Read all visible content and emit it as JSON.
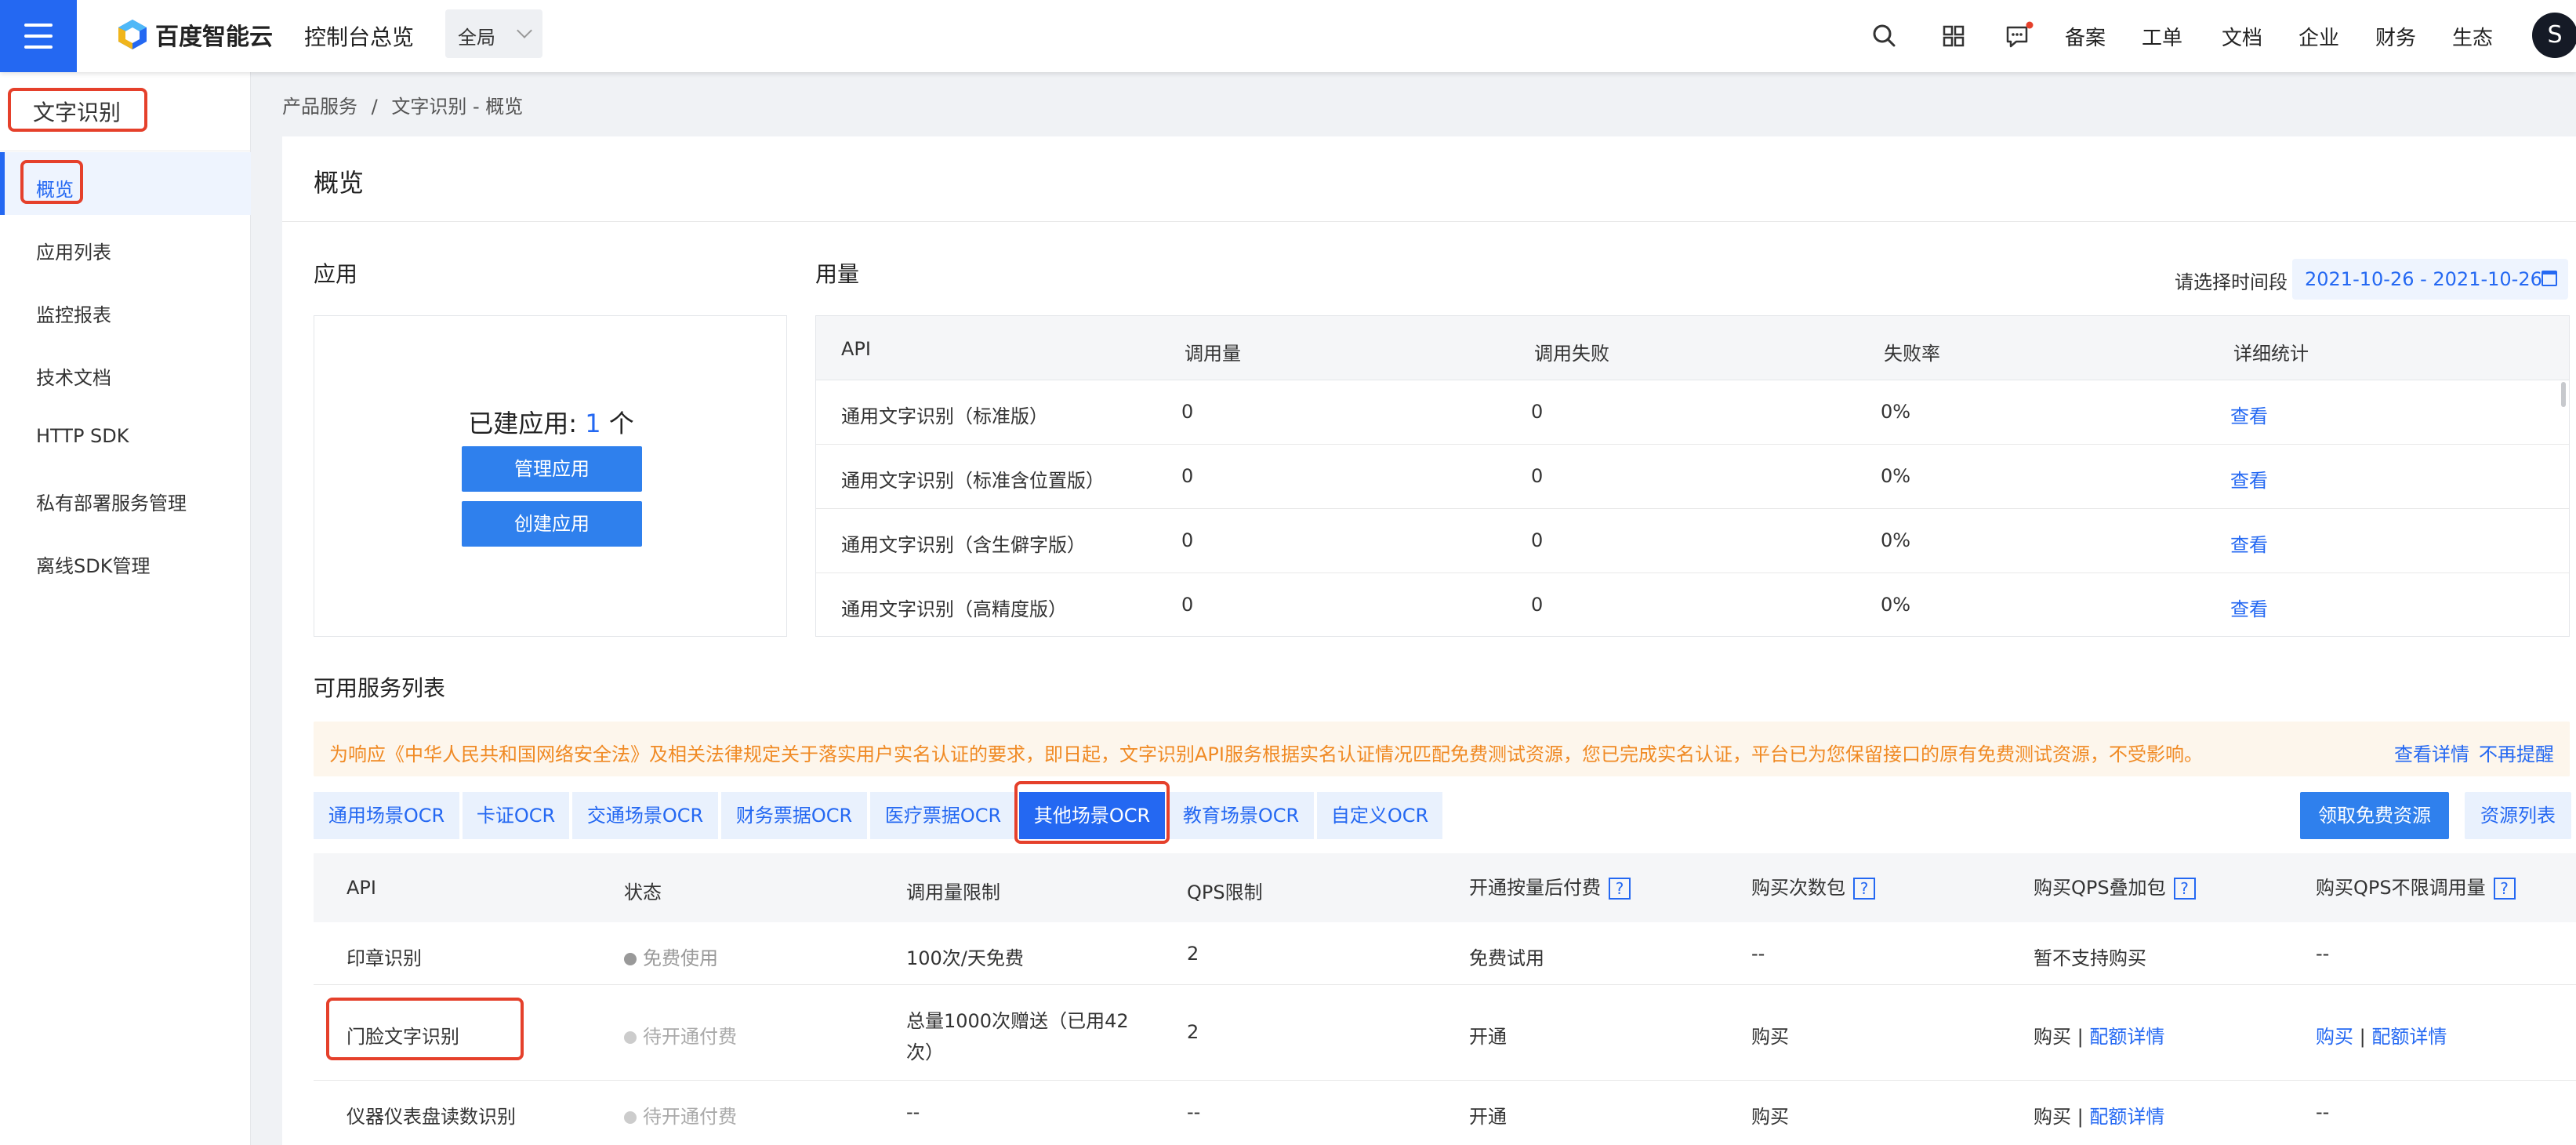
{
  "topbar": {
    "brand": "百度智能云",
    "title": "控制台总览",
    "scope": "全局",
    "nav": [
      "备案",
      "工单",
      "文档",
      "企业",
      "财务",
      "生态"
    ],
    "avatar_letter": "S",
    "icons": [
      "search-icon",
      "grid-icon",
      "message-icon"
    ]
  },
  "sidebar": {
    "title": "文字识别",
    "items": [
      {
        "label": "概览",
        "active": true
      },
      {
        "label": "应用列表"
      },
      {
        "label": "监控报表"
      },
      {
        "label": "技术文档"
      },
      {
        "label": "HTTP SDK"
      },
      {
        "label": "私有部署服务管理"
      },
      {
        "label": "离线SDK管理"
      }
    ]
  },
  "breadcrumb": {
    "root": "产品服务",
    "sep": "/",
    "current": "文字识别 - 概览"
  },
  "page_title": "概览",
  "apps": {
    "section": "应用",
    "count_prefix": "已建应用:",
    "count": "1",
    "count_suffix": "个",
    "manage_label": "管理应用",
    "create_label": "创建应用"
  },
  "usage": {
    "section": "用量",
    "period_label": "请选择时间段",
    "period_value": "2021-10-26 - 2021-10-26",
    "headers": [
      "API",
      "调用量",
      "调用失败",
      "失败率",
      "详细统计"
    ],
    "rows": [
      {
        "api": "通用文字识别（标准版）",
        "calls": "0",
        "fails": "0",
        "rate": "0%",
        "detail": "查看"
      },
      {
        "api": "通用文字识别（标准含位置版）",
        "calls": "0",
        "fails": "0",
        "rate": "0%",
        "detail": "查看"
      },
      {
        "api": "通用文字识别（含生僻字版）",
        "calls": "0",
        "fails": "0",
        "rate": "0%",
        "detail": "查看"
      },
      {
        "api": "通用文字识别（高精度版）",
        "calls": "0",
        "fails": "0",
        "rate": "0%",
        "detail": "查看"
      }
    ]
  },
  "services": {
    "section": "可用服务列表",
    "notice": "为响应《中华人民共和国网络安全法》及相关法律规定关于落实用户实名认证的要求，即日起，文字识别API服务根据实名认证情况匹配免费测试资源，您已完成实名认证，平台已为您保留接口的原有免费测试资源，不受影响。",
    "notice_detail": "查看详情",
    "notice_dismiss": "不再提醒",
    "tabs": [
      "通用场景OCR",
      "卡证OCR",
      "交通场景OCR",
      "财务票据OCR",
      "医疗票据OCR",
      "其他场景OCR",
      "教育场景OCR",
      "自定义OCR"
    ],
    "active_tab": "其他场景OCR",
    "free_button": "领取免费资源",
    "resource_button": "资源列表",
    "headers": [
      "API",
      "状态",
      "调用量限制",
      "QPS限制",
      "开通按量后付费",
      "购买次数包",
      "购买QPS叠加包",
      "购买QPS不限调用量"
    ],
    "help_mark": "?",
    "rows": [
      {
        "api": "印章识别",
        "status": "免费使用",
        "limit": "100次/天免费",
        "qps": "2",
        "postpaid": "免费试用",
        "pack": "--",
        "qps_pack_a": "暂不支持购买",
        "qps_pack_b": "",
        "unlimited_a": "--",
        "unlimited_b": ""
      },
      {
        "api": "门脸文字识别",
        "status": "待开通付费",
        "limit_line1": "总量1000次赠送（已用42",
        "limit_line2": "次）",
        "qps": "2",
        "postpaid": "开通",
        "pack": "购买",
        "qps_pack_a": "购买",
        "qps_pack_b": "配额详情",
        "unlimited_a": "购买",
        "unlimited_b": "配额详情"
      },
      {
        "api": "仪器仪表盘读数识别",
        "status": "待开通付费",
        "limit": "--",
        "qps": "--",
        "postpaid": "开通",
        "pack": "购买",
        "qps_pack_a": "购买",
        "qps_pack_b": "配额详情",
        "unlimited_a": "--",
        "unlimited_b": ""
      }
    ]
  },
  "colors": {
    "brand": "#2468f2",
    "notice": "#f08a24",
    "annotation": "#e5402b",
    "free_dot": "#999999",
    "pending_dot": "#cccccc"
  }
}
